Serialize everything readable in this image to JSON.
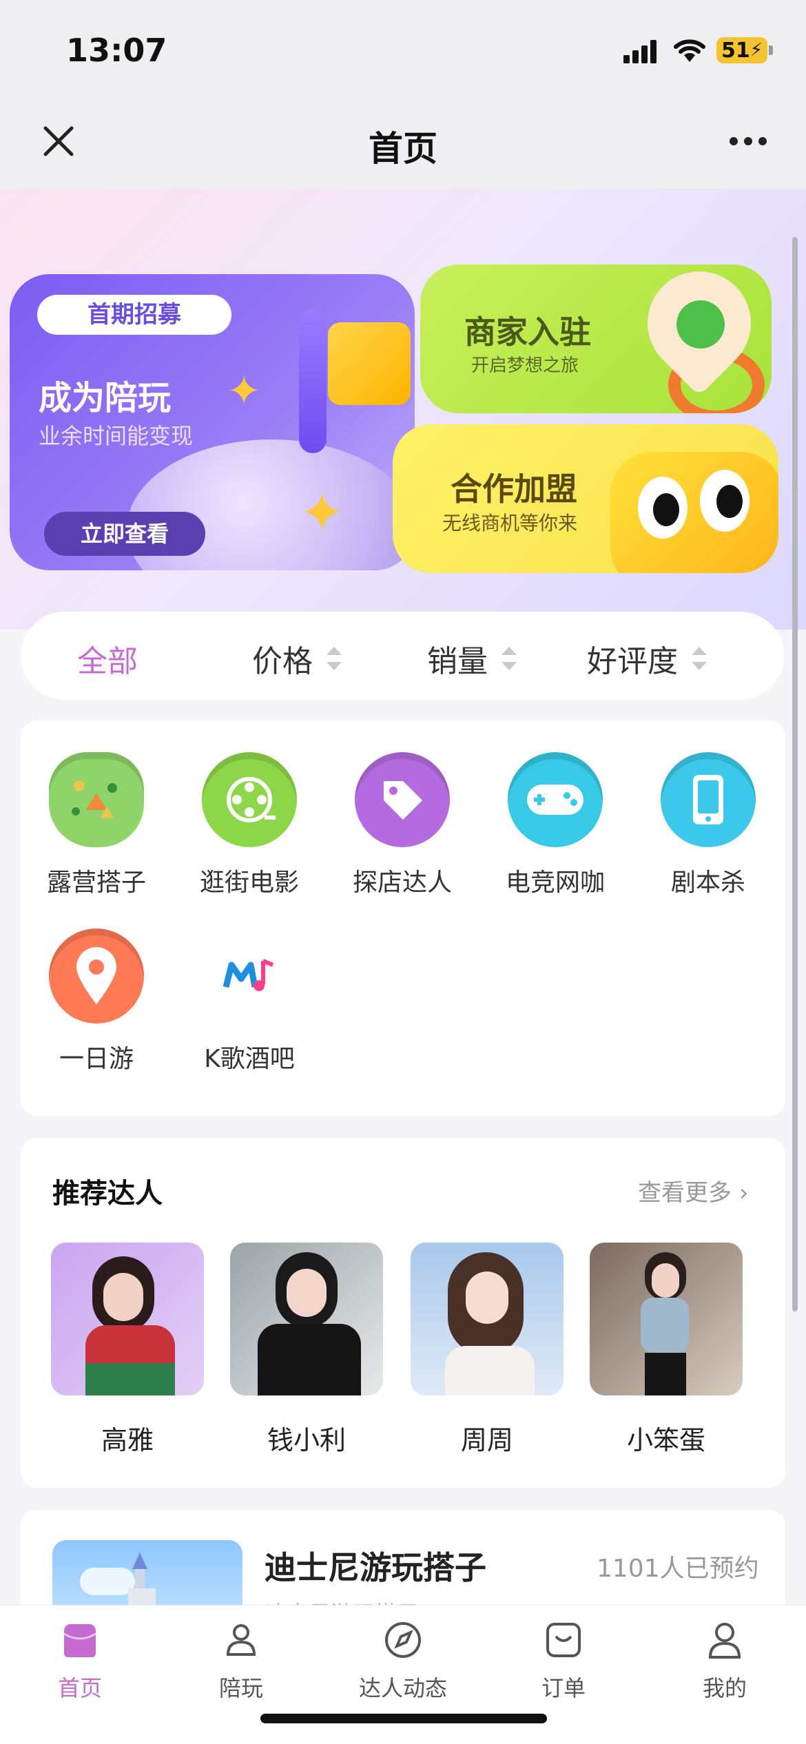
{
  "status": {
    "time": "13:07",
    "battery": "51"
  },
  "nav": {
    "title": "首页"
  },
  "banners": {
    "recruit": {
      "tag": "首期招募",
      "title": "成为陪玩",
      "subtitle": "业余时间能变现",
      "button": "立即查看"
    },
    "merchant": {
      "title": "商家入驻",
      "subtitle": "开启梦想之旅"
    },
    "franchise": {
      "title": "合作加盟",
      "subtitle": "无线商机等你来"
    }
  },
  "filters": [
    {
      "label": "全部",
      "active": true
    },
    {
      "label": "价格",
      "active": false
    },
    {
      "label": "销量",
      "active": false
    },
    {
      "label": "好评度",
      "active": false
    }
  ],
  "categories": [
    {
      "label": "露营搭子",
      "icon": "camping-map-icon",
      "color": "#8fd46a"
    },
    {
      "label": "逛街电影",
      "icon": "film-reel-icon",
      "color": "#8dd64a"
    },
    {
      "label": "探店达人",
      "icon": "tag-icon",
      "color": "#b56be0"
    },
    {
      "label": "电竞网咖",
      "icon": "gamepad-icon",
      "color": "#38c9e6"
    },
    {
      "label": "剧本杀",
      "icon": "phone-icon",
      "color": "#3cc8ea"
    },
    {
      "label": "一日游",
      "icon": "location-pin-icon",
      "color": "#ff7a55"
    },
    {
      "label": "K歌酒吧",
      "icon": "music-note-icon",
      "color": "#ffffff"
    }
  ],
  "recommend": {
    "title": "推荐达人",
    "more": "查看更多",
    "people": [
      {
        "name": "高雅"
      },
      {
        "name": "钱小利"
      },
      {
        "name": "周周"
      },
      {
        "name": "小笨蛋"
      }
    ]
  },
  "activity": {
    "title": "迪士尼游玩搭子",
    "count": "1101人已预约",
    "subtitle": "迪士尼游玩搭子"
  },
  "tabs": [
    {
      "label": "首页",
      "icon": "home-icon",
      "active": true
    },
    {
      "label": "陪玩",
      "icon": "companion-icon",
      "active": false
    },
    {
      "label": "达人动态",
      "icon": "compass-icon",
      "active": false
    },
    {
      "label": "订单",
      "icon": "order-bag-icon",
      "active": false
    },
    {
      "label": "我的",
      "icon": "profile-icon",
      "active": false
    }
  ],
  "colors": {
    "accent": "#c46ad1",
    "banner_purple": "#7d5cf2",
    "banner_green": "#b8e84a",
    "banner_yellow": "#fbe85a"
  }
}
